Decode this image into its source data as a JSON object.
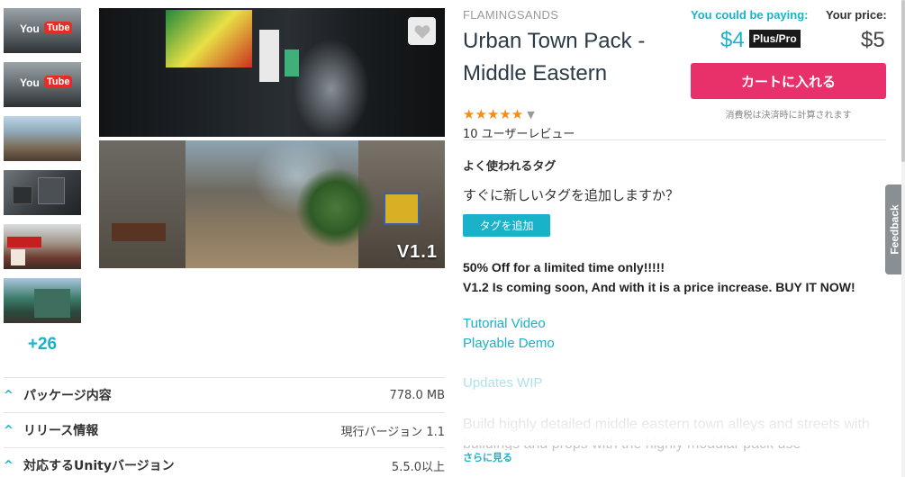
{
  "gallery": {
    "thumbnails": [
      {
        "kind": "video",
        "logo_you": "You",
        "logo_tube": "Tube"
      },
      {
        "kind": "video",
        "logo_you": "You",
        "logo_tube": "Tube"
      },
      {
        "kind": "image"
      },
      {
        "kind": "image"
      },
      {
        "kind": "image"
      },
      {
        "kind": "image"
      }
    ],
    "more_count": "+26",
    "version_badge": "V1.1"
  },
  "package_info": [
    {
      "label": "パッケージ内容",
      "value": "778.0 MB"
    },
    {
      "label": "リリース情報",
      "value": "現行バージョン 1.1"
    },
    {
      "label": "対応するUnityバージョン",
      "value": "5.5.0以上"
    }
  ],
  "product": {
    "publisher": "FLAMINGSANDS",
    "title": "Urban Town Pack - Middle Eastern",
    "stars": "★★★★★",
    "star_count": 5,
    "reviews": "10 ユーザーレビュー"
  },
  "pricing": {
    "could_be_paying_label": "You could be paying:",
    "your_price_label": "Your price:",
    "sale_price": "$4",
    "plus_badge": "Plus/Pro",
    "regular_price": "$5",
    "cart_button": "カートに入れる",
    "tax_note": "消費税は決済時に計算されます"
  },
  "tags": {
    "heading": "よく使われるタグ",
    "question": "すぐに新しいタグを追加しますか？",
    "add_button": "タグを追加"
  },
  "description": {
    "line1": "50% Off for a limited time only!!!!!",
    "line2": "V1.2 Is coming soon, And with it is a price increase. BUY IT NOW!",
    "link_tutorial": "Tutorial Video",
    "link_demo": "Playable Demo",
    "link_updates": "Updates WIP",
    "body": "Build highly detailed middle eastern town alleys and streets with buildings and props with the highly modular pack use",
    "see_more": "さらに見る"
  },
  "feedback_tab": "Feedback",
  "colors": {
    "accent": "#1ab2c8",
    "cart": "#e8306a",
    "stars": "#f28c1b"
  }
}
